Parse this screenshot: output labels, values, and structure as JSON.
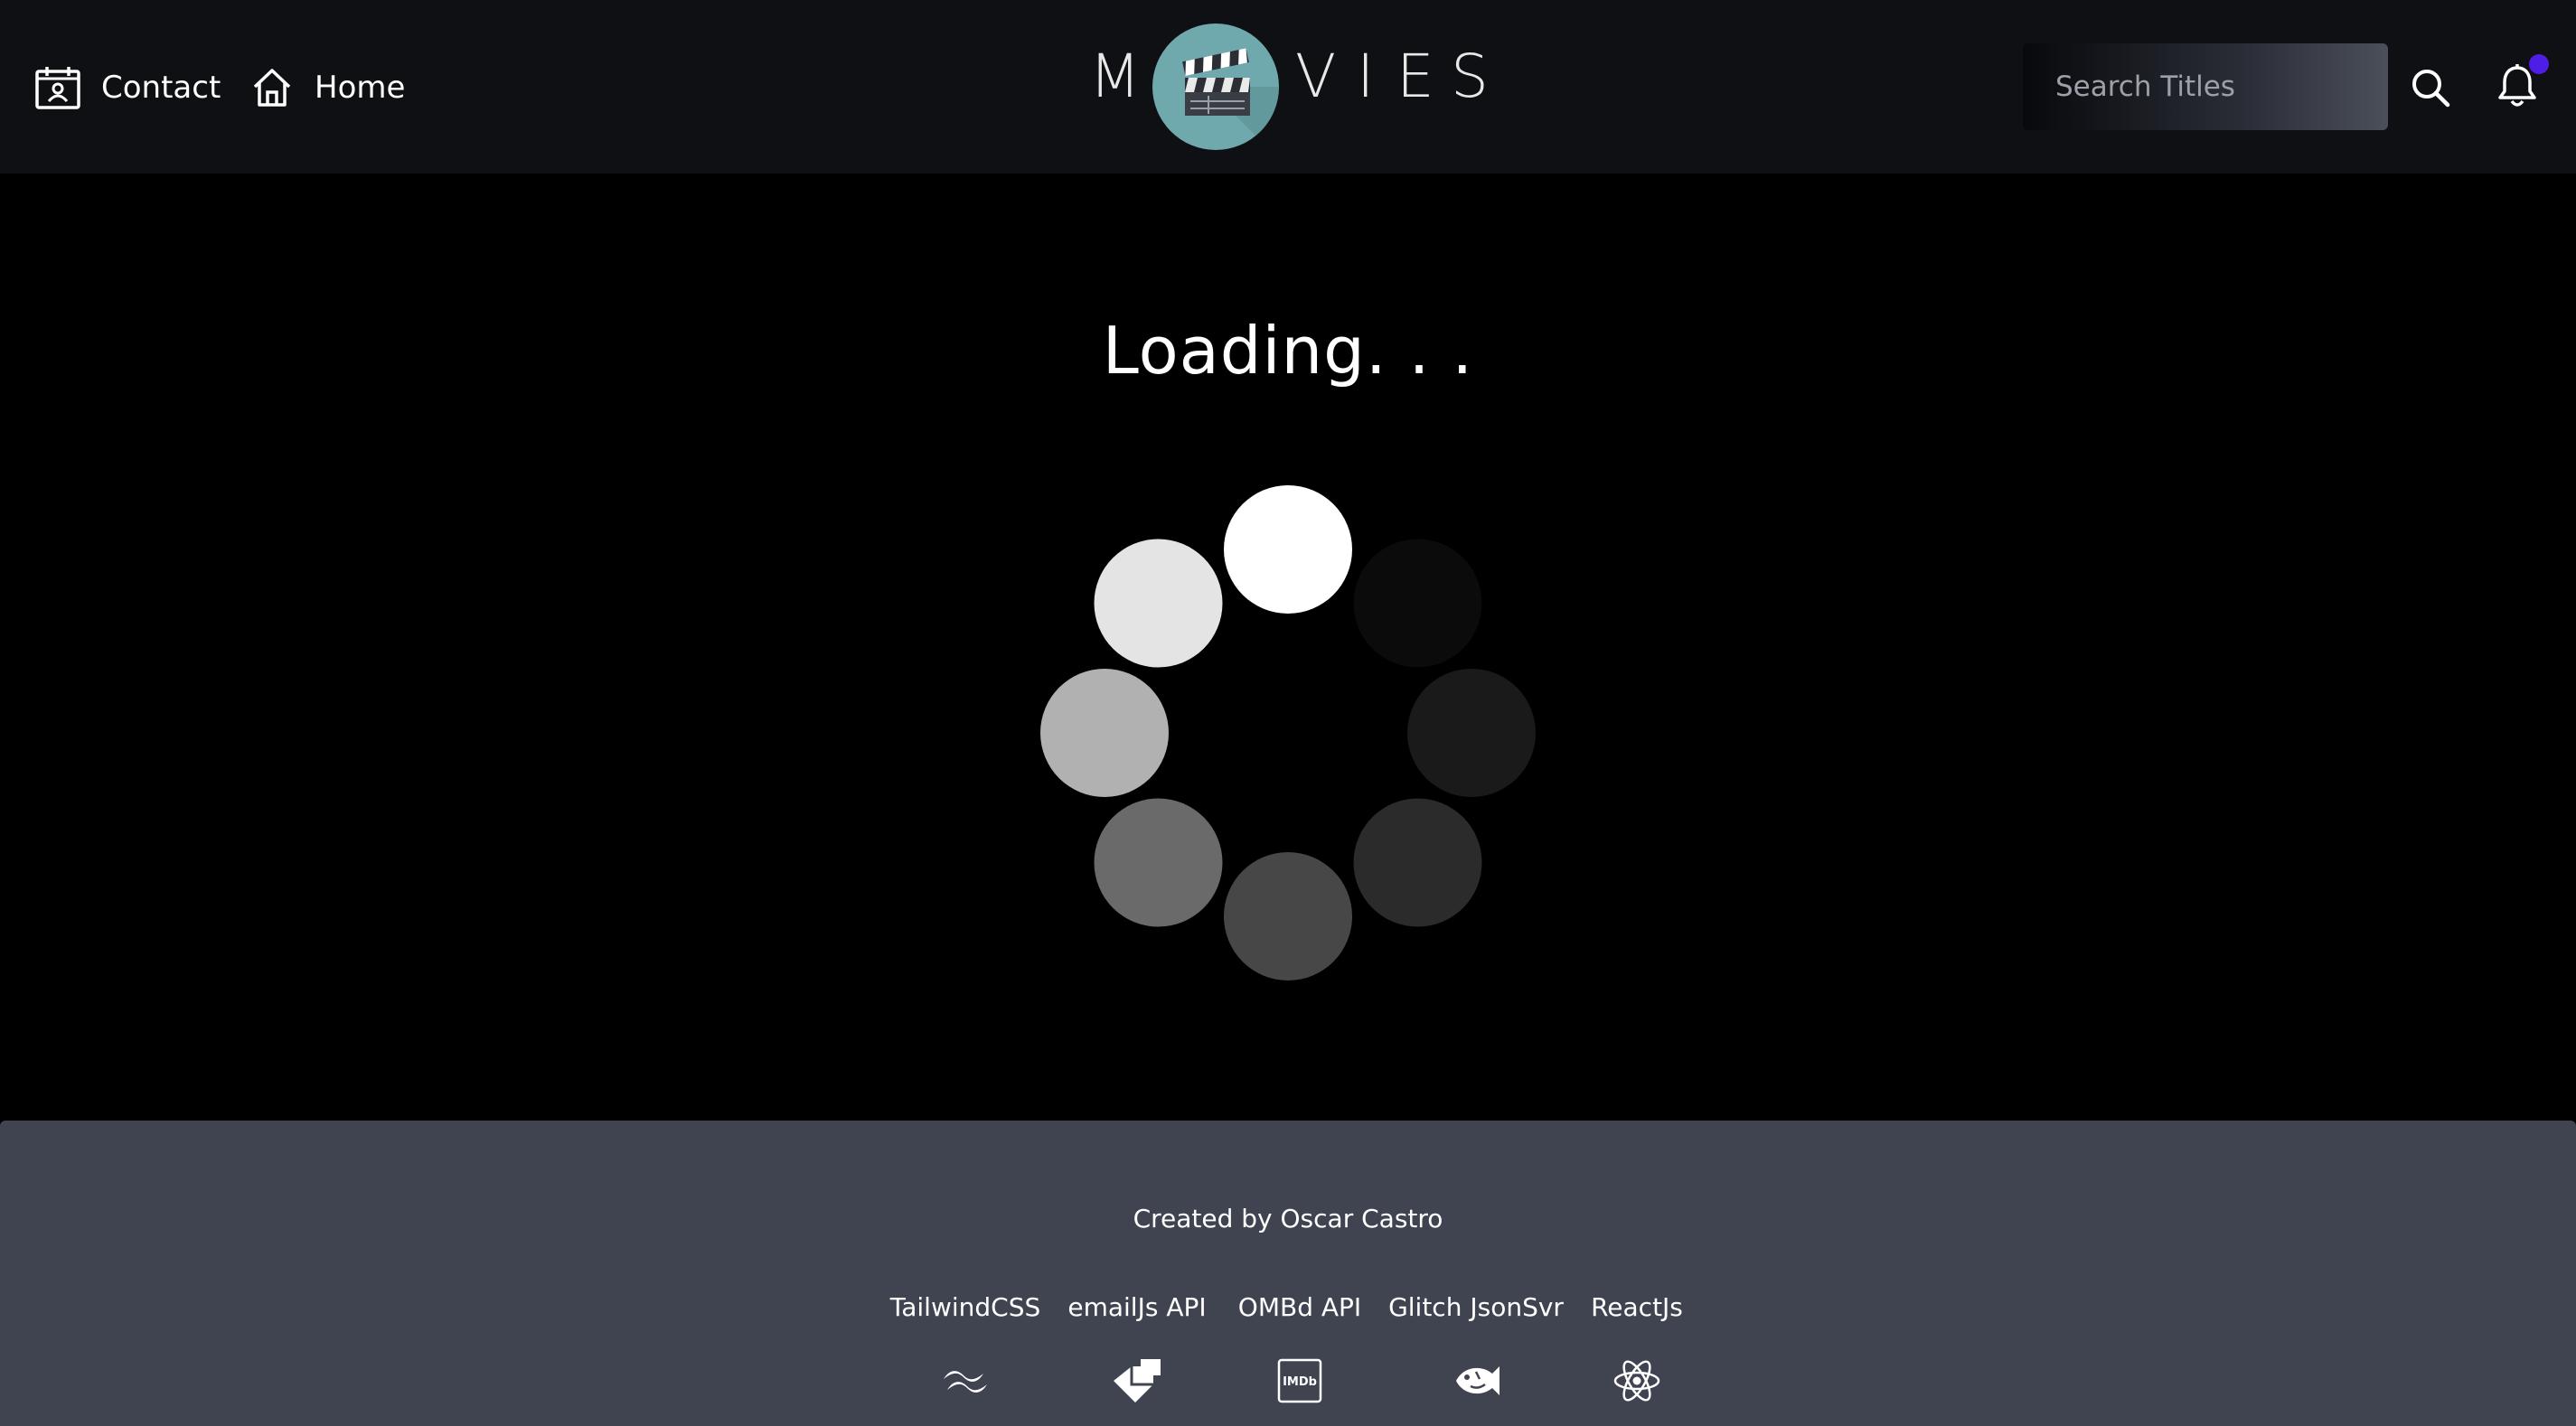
{
  "nav": {
    "contact_label": "Contact",
    "contact_icon": "calendar-contact-icon",
    "home_label": "Home",
    "home_icon": "home-icon"
  },
  "logo": {
    "letters": [
      "M",
      "V",
      "I",
      "E",
      "S"
    ],
    "emblem_icon": "clapperboard-icon",
    "emblem_color": "#6fa9ad"
  },
  "search": {
    "placeholder": "Search Titles",
    "value": "",
    "button_icon": "search-icon"
  },
  "notifications": {
    "icon": "bell-icon",
    "indicator_color": "#4f1ee6"
  },
  "main": {
    "loading_text": "Loading. . ."
  },
  "spinner": {
    "dot_shades": [
      "#ffffff",
      "#0b0b0b",
      "#1a1a1a",
      "#2b2b2b",
      "#474747",
      "#6a6a6a",
      "#b1b1b1",
      "#e4e4e4"
    ]
  },
  "footer": {
    "credit": "Created by Oscar Castro",
    "tech": [
      {
        "label": "TailwindCSS",
        "icon": "tailwind-icon"
      },
      {
        "label": "emailJs API",
        "icon": "emailjs-icon"
      },
      {
        "label": "OMBd API",
        "icon": "imdb-icon"
      },
      {
        "label": "Glitch JsonSvr",
        "icon": "glitch-fish-icon"
      },
      {
        "label": "ReactJs",
        "icon": "react-icon"
      }
    ],
    "imdb_badge_text": "IMDb"
  },
  "colors": {
    "header_bg": "#0f1014",
    "page_bg": "#000000",
    "footer_bg": "#3f4450"
  }
}
